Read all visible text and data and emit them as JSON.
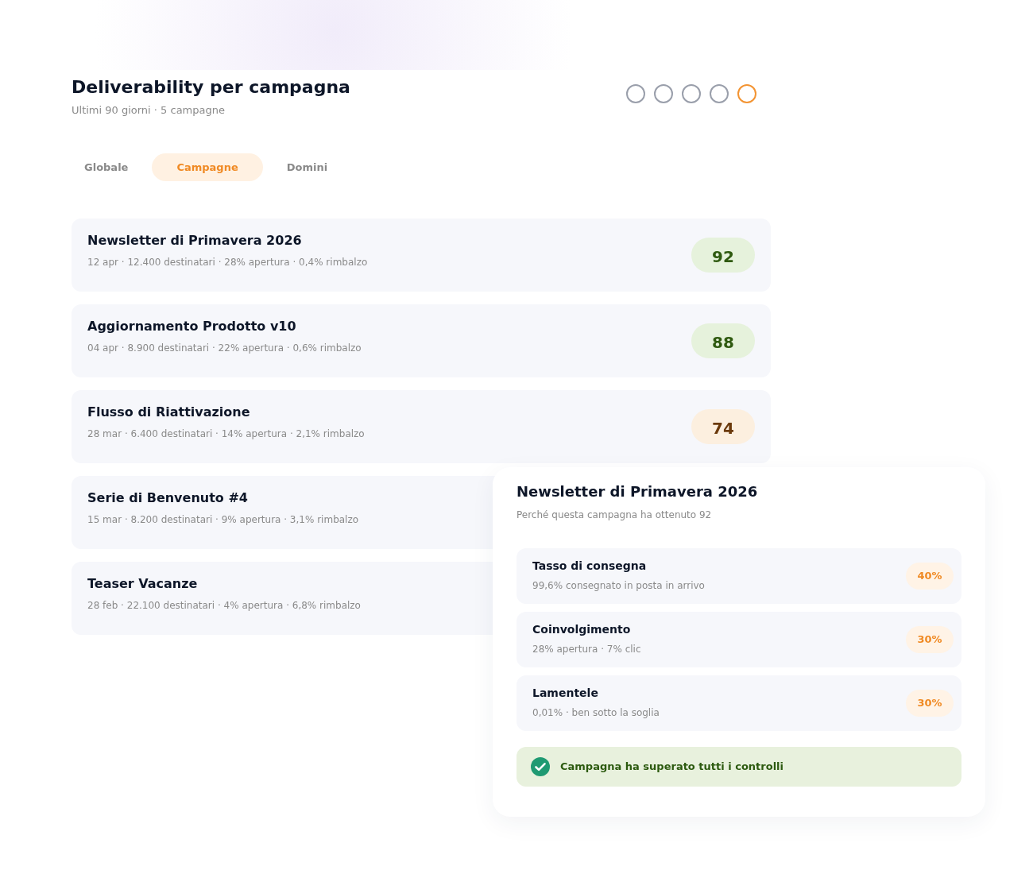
{
  "header": {
    "title": "Deliverability per campagna",
    "subtitle": "Ultimi 90 giorni · 5 campagne"
  },
  "steps": [
    {
      "selected": false
    },
    {
      "selected": false
    },
    {
      "selected": false
    },
    {
      "selected": false
    },
    {
      "selected": true
    }
  ],
  "tabs": [
    {
      "label": "Globale",
      "selected": false
    },
    {
      "label": "Campagne",
      "selected": true
    },
    {
      "label": "Domini",
      "selected": false
    }
  ],
  "campaigns": [
    {
      "name": "Newsletter di Primavera 2026",
      "details": "12 apr · 12.400 destinatari · 28% apertura · 0,4% rimbalzo",
      "score": "92",
      "warning": false
    },
    {
      "name": "Aggiornamento Prodotto v10",
      "details": "04 apr · 8.900 destinatari · 22% apertura · 0,6% rimbalzo",
      "score": "88",
      "warning": false
    },
    {
      "name": "Flusso di Riattivazione",
      "details": "28 mar · 6.400 destinatari · 14% apertura · 2,1% rimbalzo",
      "score": "74",
      "warning": true
    },
    {
      "name": "Serie di Benvenuto #4",
      "details": "15 mar · 8.200 destinatari · 9% apertura · 3,1% rimbalzo"
    },
    {
      "name": "Teaser Vacanze",
      "details": "28 feb · 22.100 destinatari · 4% apertura · 6,8% rimbalzo"
    }
  ],
  "detail": {
    "title": "Newsletter di Primavera 2026",
    "subtitle": "Perché questa campagna ha ottenuto 92",
    "factors": [
      {
        "name": "Tasso di consegna",
        "details": "99,6% consegnato in posta in arrivo",
        "weight": "40%"
      },
      {
        "name": "Coinvolgimento",
        "details": "28% apertura · 7% clic",
        "weight": "30%"
      },
      {
        "name": "Lamentele",
        "details": "0,01% · ben sotto la soglia",
        "weight": "30%"
      }
    ],
    "status": {
      "passed": true,
      "message": "Campagna ha superato tutti i controlli"
    }
  }
}
